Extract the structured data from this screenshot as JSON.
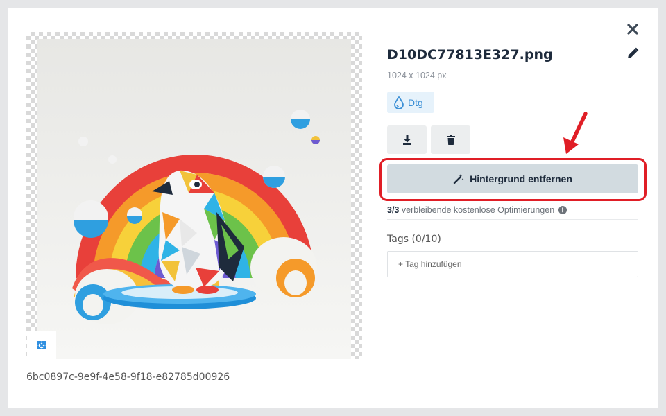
{
  "image": {
    "uuid": "6bc0897c-9e9f-4e58-9f18-e82785d00926",
    "alt": "penguin-rainbow-artwork"
  },
  "file": {
    "name": "D10DC77813E327.png",
    "dimensions": "1024 x 1024 px"
  },
  "tag_chip": {
    "icon": "water-drop-icon",
    "label": "Dtg"
  },
  "actions": {
    "download_icon": "download-icon",
    "delete_icon": "trash-icon",
    "remove_background_label": "Hintergrund entfernen",
    "remove_background_icon": "magic-wand-icon"
  },
  "quota": {
    "count": "3/3",
    "text": "verbleibende kostenlose Optimierungen",
    "info_icon": "info-icon"
  },
  "tags": {
    "label": "Tags (0/10)",
    "add_placeholder": "+ Tag hinzufügen"
  },
  "colors": {
    "highlight": "#e01e26",
    "accent": "#3a8fd6",
    "title": "#1e2b3c"
  }
}
